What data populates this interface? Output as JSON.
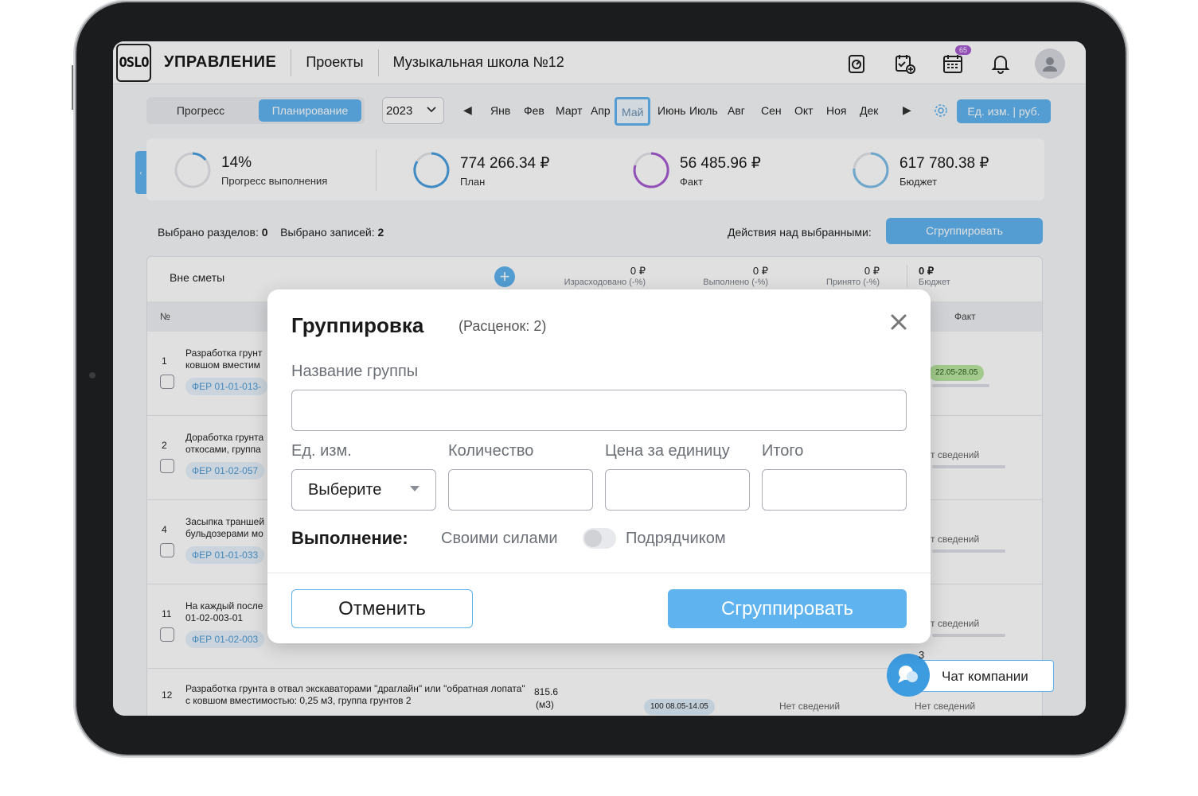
{
  "header": {
    "logo_text": "OSLO",
    "title": "УПРАВЛЕНИЕ",
    "projects_link": "Проекты",
    "project_name": "Музыкальная школа №12",
    "calendar_badge": "65"
  },
  "toolbar": {
    "mode_progress": "Прогресс",
    "mode_planning": "Планирование",
    "year": "2023",
    "months": [
      "Янв",
      "Фев",
      "Март",
      "Апр",
      "Май",
      "Июнь",
      "Июль",
      "Авг",
      "Сен",
      "Окт",
      "Ноя",
      "Дек"
    ],
    "selected_month": "Май",
    "units_button": "Ед. изм. | руб."
  },
  "summary": {
    "progress_value": "14%",
    "progress_label": "Прогресс выполнения",
    "plan_value": "774 266.34 ₽",
    "plan_label": "План",
    "fact_value": "56 485.96 ₽",
    "fact_label": "Факт",
    "budget_value": "617 780.38 ₽",
    "budget_label": "Бюджет"
  },
  "selection": {
    "sections_label": "Выбрано разделов:",
    "sections_count": "0",
    "records_label": "Выбрано записей:",
    "records_count": "2",
    "actions_label": "Действия над выбранными:",
    "group_button": "Сгруппировать"
  },
  "table": {
    "section_title": "Вне сметы",
    "metrics": [
      {
        "value": "0 ₽",
        "label": "Израсходовано (-%)"
      },
      {
        "value": "0 ₽",
        "label": "Выполнено (-%)"
      },
      {
        "value": "0 ₽",
        "label": "Принято (-%)"
      },
      {
        "value": "0 ₽",
        "label": "Бюджет"
      }
    ],
    "col_num": "№",
    "col_fact": "Факт",
    "rows": [
      {
        "num": "1",
        "line1": "Разработка грунт",
        "line2": "ковшом вместим",
        "code": "ФЕР 01-01-013-",
        "fact": "22.05-28.05"
      },
      {
        "num": "2",
        "line1": "Доработка грунта",
        "line2": "откосами, группа",
        "code": "ФЕР 01-02-057",
        "fact": "т сведений"
      },
      {
        "num": "4",
        "line1": "Засыпка траншей",
        "line2": "бульдозерами мо",
        "code": "ФЕР 01-01-033",
        "fact": "т сведений"
      },
      {
        "num": "11",
        "line1": "На каждый после",
        "line2": "01-02-003-01",
        "code": "ФЕР 01-02-003",
        "fact": "т сведений"
      },
      {
        "num": "12",
        "line1": "Разработка грунта в отвал экскаваторами \"драглайн\" или \"обратная лопата\"",
        "line2": "с ковшом вместимостью: 0,25 м3, группа грунтов 2",
        "qty": "815.6",
        "unit": "(м3)",
        "progress": "100",
        "dates": "08.05-14.05",
        "no_data_1": "Нет сведений",
        "no_data_2": "Нет сведений"
      }
    ]
  },
  "chat": {
    "label": "Чат компании",
    "count": "3"
  },
  "modal": {
    "title": "Группировка",
    "subtitle": "(Расценок: 2)",
    "group_name_label": "Название группы",
    "group_name_value": "",
    "unit_label": "Ед. изм.",
    "unit_select": "Выберите",
    "quantity_label": "Количество",
    "price_label": "Цена за единицу",
    "total_label": "Итого",
    "execution_label": "Выполнение:",
    "own_forces": "Своими силами",
    "contractor": "Подрядчиком",
    "cancel_button": "Отменить",
    "group_button": "Сгруппировать"
  },
  "colors": {
    "accent": "#5fb3ef",
    "plan_ring": "#4a9fe0",
    "fact_ring": "#a65bd1",
    "fact_chip": "#b9e6a0"
  }
}
